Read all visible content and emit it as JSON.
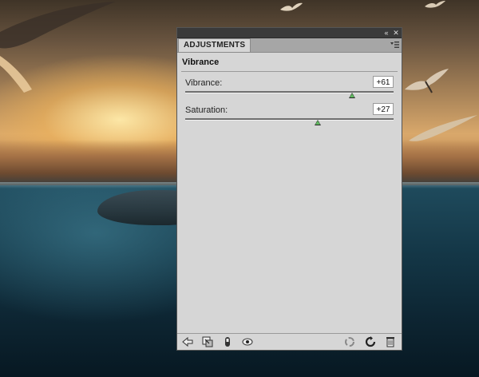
{
  "panel": {
    "tab_label": "ADJUSTMENTS",
    "title_bar_buttons": [
      "collapse-icon",
      "close-icon"
    ],
    "menu_icon": "panel-menu-icon",
    "adjustment_title": "Vibrance",
    "controls": [
      {
        "label": "Vibrance:",
        "value": "+61",
        "slider_position": 0.8
      },
      {
        "label": "Saturation:",
        "value": "+27",
        "slider_position": 0.635
      }
    ],
    "footer_icons_left": [
      "back-arrow-icon",
      "clip-to-layer-icon",
      "layer-visibility-icon",
      "view-previous-state-icon"
    ],
    "footer_icons_right": [
      "reset-all-icon",
      "reset-icon",
      "delete-icon"
    ]
  },
  "colors": {
    "panel_bg": "#d6d6d6",
    "slider_thumb": "#5fb85f",
    "title_bar": "#3a3a3a"
  }
}
